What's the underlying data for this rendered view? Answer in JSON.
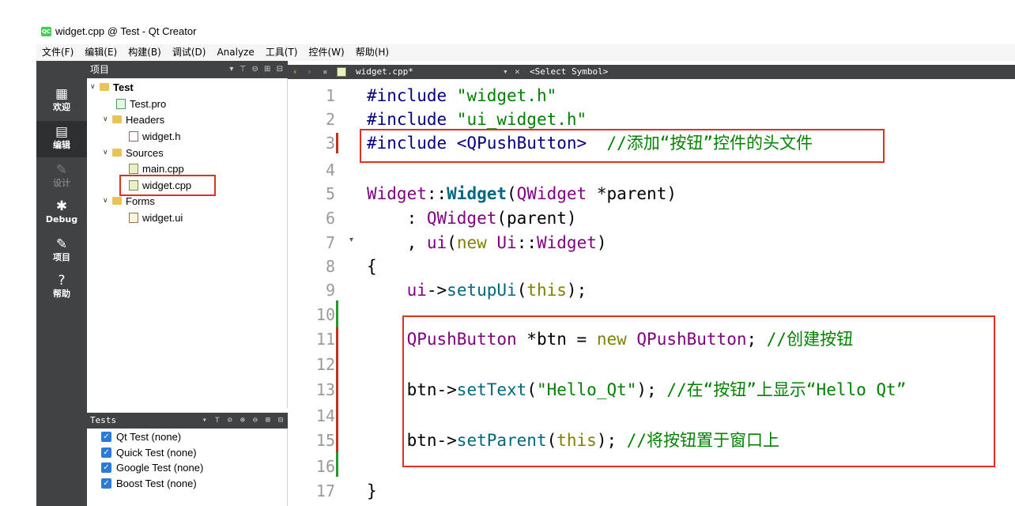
{
  "window": {
    "title": "widget.cpp @ Test - Qt Creator"
  },
  "menu": [
    "文件(F)",
    "编辑(E)",
    "构建(B)",
    "调试(D)",
    "Analyze",
    "工具(T)",
    "控件(W)",
    "帮助(H)"
  ],
  "modes": [
    {
      "label": "欢迎",
      "icon": "grid-icon",
      "glyph": "▦"
    },
    {
      "label": "编辑",
      "icon": "edit-icon",
      "glyph": "▤"
    },
    {
      "label": "设计",
      "icon": "pen-icon",
      "glyph": "✎"
    },
    {
      "label": "Debug",
      "icon": "bug-icon",
      "glyph": "✱"
    },
    {
      "label": "项目",
      "icon": "wrench-icon",
      "glyph": "✎"
    },
    {
      "label": "帮助",
      "icon": "help-icon",
      "glyph": "?"
    }
  ],
  "project_panel": {
    "title": "项目",
    "tree": [
      {
        "label": "Test",
        "arrow": "∨",
        "icon": "folder"
      },
      {
        "label": "Test.pro",
        "icon": "pro"
      },
      {
        "label": "Headers",
        "arrow": "∨",
        "icon": "folder"
      },
      {
        "label": "widget.h",
        "icon": "h"
      },
      {
        "label": "Sources",
        "arrow": "∨",
        "icon": "folder"
      },
      {
        "label": "main.cpp",
        "icon": "cpp"
      },
      {
        "label": "widget.cpp",
        "icon": "cpp"
      },
      {
        "label": "Forms",
        "arrow": "∨",
        "icon": "folder"
      },
      {
        "label": "widget.ui",
        "icon": "ui"
      }
    ]
  },
  "tests_panel": {
    "title": "Tests",
    "items": [
      "Qt Test (none)",
      "Quick Test (none)",
      "Google Test (none)",
      "Boost Test (none)"
    ]
  },
  "editor": {
    "file_tab": "widget.cpp*",
    "symbol_selector": "<Select Symbol>",
    "close_glyph": "×",
    "line_numbers": [
      "1",
      "2",
      "3",
      "4",
      "5",
      "6",
      "7",
      "8",
      "9",
      "10",
      "11",
      "12",
      "13",
      "14",
      "15",
      "16",
      "17"
    ],
    "lines": {
      "l1_pre": "#include ",
      "l1_str": "\"widget.h\"",
      "l2_pre": "#include ",
      "l2_str": "\"ui_widget.h\"",
      "l3_pre": "#include <QPushButton>",
      "l3_cmt": "  //添加“按钮”控件的头文件",
      "l5_cls": "Widget",
      "l5_sep": "::",
      "l5_fn": "Widget",
      "l5_p1": "(",
      "l5_cls2": "QWidget",
      "l5_rest": " *parent)",
      "l6_a": "    : ",
      "l6_cls": "QWidget",
      "l6_rest": "(parent)",
      "l7_a": "    , ",
      "l7_ui": "ui",
      "l7_p": "(",
      "l7_kw": "new",
      "l7_sp": " ",
      "l7_cls": "Ui",
      "l7_sep": "::",
      "l7_cls2": "Widget",
      "l7_end": ")",
      "l8": "{",
      "l9_a": "    ",
      "l9_ui": "ui",
      "l9_arrow": "->",
      "l9_fn": "setupUi",
      "l9_p": "(",
      "l9_kw": "this",
      "l9_end": ");",
      "l11_a": "    ",
      "l11_cls": "QPushButton",
      "l11_mid": " *btn = ",
      "l11_kw": "new",
      "l11_sp": " ",
      "l11_cls2": "QPushButton",
      "l11_end": "; ",
      "l11_cmt": "//创建按钮",
      "l13_a": "    btn->",
      "l13_fn": "setText",
      "l13_p": "(",
      "l13_str": "\"Hello_Qt\"",
      "l13_end": "); ",
      "l13_cmt": "//在“按钮”上显示“Hello Qt”",
      "l15_a": "    btn->",
      "l15_fn": "setParent",
      "l15_p": "(",
      "l15_kw": "this",
      "l15_end": "); ",
      "l15_cmt": "//将按钮置于窗口上",
      "l17": "}"
    }
  }
}
